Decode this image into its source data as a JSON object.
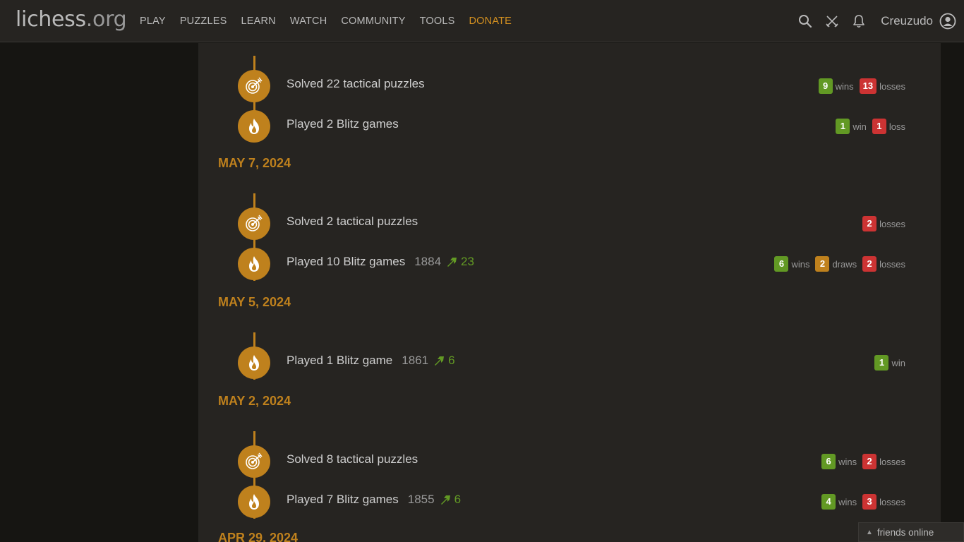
{
  "header": {
    "logo_main": "lichess",
    "logo_tld": ".org",
    "nav": [
      "PLAY",
      "PUZZLES",
      "LEARN",
      "WATCH",
      "COMMUNITY",
      "TOOLS",
      "DONATE"
    ],
    "username": "Creuzudo",
    "icons": [
      "search-icon",
      "swords-icon",
      "bell-icon",
      "user-circle-icon"
    ]
  },
  "colors": {
    "accent": "#bf811d",
    "win": "#629924",
    "loss": "#cc3333",
    "draw": "#bf811d",
    "donate": "#d59120"
  },
  "timeline": {
    "block0": {
      "e0": {
        "text": "Solved 22 tactical puzzles",
        "wins": "9",
        "wins_word": "wins",
        "losses": "13",
        "losses_word": "losses"
      },
      "e1": {
        "text": "Played 2 Blitz games",
        "wins": "1",
        "wins_word": "win",
        "losses": "1",
        "losses_word": "loss"
      }
    },
    "block1": {
      "date": "MAY 7, 2024",
      "e0": {
        "text": "Solved 2 tactical puzzles",
        "losses": "2",
        "losses_word": "losses"
      },
      "e1": {
        "text": "Played 10 Blitz games",
        "rating": "1884",
        "diff": "23",
        "wins": "6",
        "wins_word": "wins",
        "draws": "2",
        "draws_word": "draws",
        "losses": "2",
        "losses_word": "losses"
      }
    },
    "block2": {
      "date": "MAY 5, 2024",
      "e0": {
        "text": "Played 1 Blitz game",
        "rating": "1861",
        "diff": "6",
        "wins": "1",
        "wins_word": "win"
      }
    },
    "block3": {
      "date": "MAY 2, 2024",
      "e0": {
        "text": "Solved 8 tactical puzzles",
        "wins": "6",
        "wins_word": "wins",
        "losses": "2",
        "losses_word": "losses"
      },
      "e1": {
        "text": "Played 7 Blitz games",
        "rating": "1855",
        "diff": "6",
        "wins": "4",
        "wins_word": "wins",
        "losses": "3",
        "losses_word": "losses"
      }
    },
    "block4": {
      "date": "APR 29, 2024"
    }
  },
  "friends_label": "friends online"
}
